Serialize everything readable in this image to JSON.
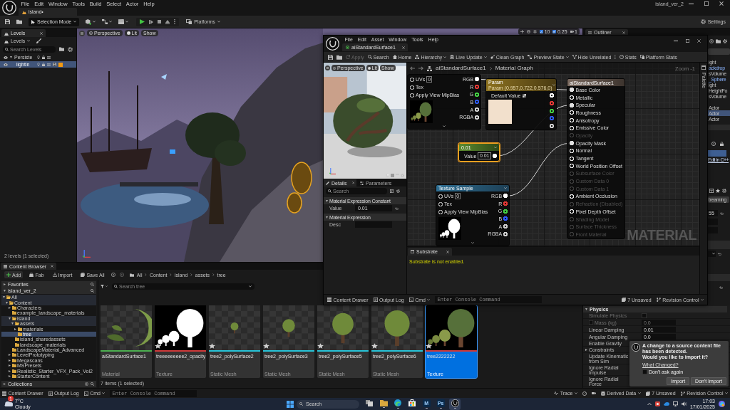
{
  "editor": {
    "menu": [
      "File",
      "Edit",
      "Window",
      "Tools",
      "Build",
      "Select",
      "Actor",
      "Help"
    ],
    "level_tab": {
      "label": "island•",
      "selected": true
    },
    "project": "island_ver_2",
    "toolbar": {
      "mode": "Selection Mode",
      "platforms": "Platforms",
      "settings": "Settings"
    }
  },
  "levels_panel": {
    "tab": "Levels",
    "dropdown": "Levels",
    "search": {
      "placeholder": "Search Levels"
    },
    "levels": [
      {
        "name": "Persiste",
        "selected": false,
        "current": false,
        "expanded": true
      },
      {
        "name": "lightin",
        "selected": true,
        "current": true,
        "color": "#f39a12"
      }
    ],
    "status": "2 levels (1 selected)"
  },
  "viewport": {
    "buttons": [
      "Perspective",
      "Lit",
      "Show"
    ],
    "snap_values": [
      "10",
      "0.25",
      "1"
    ]
  },
  "outliner": {
    "tab": "Outliner",
    "rows": [
      {
        "label": "ight",
        "selected": false,
        "highlighted": false
      },
      {
        "label": "ackdrop",
        "selected": false,
        "highlighted": true
      },
      {
        "label": "sVolume",
        "selected": false,
        "highlighted": false
      },
      {
        "label": "_Sphere",
        "selected": false,
        "highlighted": true
      },
      {
        "label": "ight",
        "selected": false,
        "highlighted": false
      },
      {
        "label": "HeightFo",
        "selected": false,
        "highlighted": false
      },
      {
        "label": "sVolume",
        "selected": false,
        "highlighted": false
      },
      {
        "label": "Actor",
        "selected": false,
        "highlighted": false
      },
      {
        "label": "Actor",
        "selected": true,
        "highlighted": false
      },
      {
        "label": "Actor",
        "selected": false,
        "highlighted": false
      }
    ]
  },
  "details_panel": {
    "edit_link": "Edit in C++",
    "streaming_button": "treaming",
    "field_value": "55",
    "physics": {
      "title": "Physics",
      "expanded": true,
      "rows": [
        {
          "label": "Simulate Physics",
          "kind": "checkbox",
          "checked": false,
          "disabled": true
        },
        {
          "label": "Mass (kg)",
          "kind": "number",
          "value": "0.0",
          "override_checked": false,
          "disabled": true
        },
        {
          "label": "Linear Damping",
          "kind": "number",
          "value": "0.01",
          "disabled": false
        },
        {
          "label": "Angular Damping",
          "kind": "number",
          "value": "0.0",
          "disabled": false
        },
        {
          "label": "Enable Gravity",
          "kind": "label",
          "disabled": false
        },
        {
          "label": "Constraints",
          "kind": "group",
          "expanded": false,
          "disabled": false
        },
        {
          "label": "Update Kinematic from Sim",
          "kind": "label",
          "disabled": false
        },
        {
          "label": "Ignore Radial Impulse",
          "kind": "label",
          "disabled": false
        },
        {
          "label": "Ignore Radial Force",
          "kind": "label",
          "disabled": false
        }
      ]
    }
  },
  "material_editor": {
    "menu": [
      "File",
      "Edit",
      "Asset",
      "Window",
      "Tools",
      "Help"
    ],
    "tab": {
      "label": "aiStandardSurface1",
      "selected": true
    },
    "toolbar": [
      {
        "label": "Apply",
        "disabled": true,
        "dropdown": false
      },
      {
        "label": "Search",
        "disabled": false,
        "dropdown": false
      },
      {
        "label": "Home",
        "disabled": false,
        "dropdown": false
      },
      {
        "label": "Hierarchy",
        "disabled": false,
        "dropdown": true
      },
      {
        "label": "Live Update",
        "disabled": false,
        "dropdown": true
      },
      {
        "label": "Clean Graph",
        "disabled": false,
        "dropdown": false
      },
      {
        "label": "Preview State",
        "disabled": false,
        "dropdown": true
      },
      {
        "label": "Hide Unrelated",
        "disabled": false,
        "dropdown": false
      },
      {
        "label": "Stats",
        "disabled": false,
        "dropdown": false
      },
      {
        "label": "Platform Stats",
        "disabled": false,
        "dropdown": false
      }
    ],
    "preview": {
      "buttons": [
        "Perspective",
        "Lit",
        "Show"
      ]
    },
    "details": {
      "tabs": [
        {
          "label": "Details",
          "selected": true
        },
        {
          "label": "Parameters",
          "selected": false
        }
      ],
      "search": {
        "placeholder": "Search"
      },
      "sections": [
        {
          "title": "Material Expression Constant",
          "rows": [
            {
              "label": "Value",
              "value": "0.01",
              "modified": true
            }
          ]
        },
        {
          "title": "Material Expression",
          "rows": [
            {
              "label": "Desc",
              "modified": false
            }
          ]
        }
      ]
    },
    "graph": {
      "breadcrumb": [
        "aiStandardSurface1",
        "Material Graph"
      ],
      "zoom": "Zoom -1",
      "label": "MATERIAL",
      "palette": "Palette",
      "nodes": [
        {
          "kind": "texture",
          "selected": false,
          "thumbnail": {
            "kind": "color"
          },
          "inputs": [
            {
              "label": "UVs",
              "value": "0",
              "connected": false
            },
            {
              "label": "Tex",
              "connected": false
            },
            {
              "label": "Apply View MipBias",
              "connected": false
            }
          ],
          "outputs": [
            {
              "label": "RGB",
              "color": "#ffffff",
              "connected": true
            },
            {
              "label": "R",
              "color": "#e53935",
              "connected": false
            },
            {
              "label": "G",
              "color": "#43d043",
              "connected": false
            },
            {
              "label": "B",
              "color": "#2f5bff",
              "connected": false
            },
            {
              "label": "A",
              "color": "#cfcfcf",
              "connected": false
            },
            {
              "label": "RGBA",
              "color": "#cfcfcf",
              "connected": false
            }
          ]
        },
        {
          "kind": "vector",
          "title": "Param",
          "subtitle": "Param (0.957,0.722,0.576,0)",
          "selected": false,
          "color": "#f2e0cc",
          "inputs": [
            {
              "label": "Default Value"
            }
          ],
          "outputs": [
            {
              "color": "#ffffff",
              "connected": false
            },
            {
              "color": "#e53935",
              "connected": false
            },
            {
              "color": "#43d043",
              "connected": false
            },
            {
              "color": "#2f5bff",
              "connected": false
            },
            {
              "color": "#cfcfcf",
              "connected": false
            }
          ]
        },
        {
          "kind": "constant",
          "title": "0.01",
          "selected": true,
          "inputs": [
            {
              "label": "Value",
              "value": "0.01"
            }
          ],
          "outputs": [
            {
              "color": "#ffffff",
              "connected": true
            }
          ]
        },
        {
          "kind": "texture",
          "title": "Texture Sample",
          "selected": false,
          "thumbnail": {
            "kind": "mask"
          },
          "inputs": [
            {
              "label": "UVs",
              "value": "0",
              "connected": false
            },
            {
              "label": "Tex",
              "connected": false
            },
            {
              "label": "Apply View MipBias",
              "connected": false
            }
          ],
          "outputs": [
            {
              "label": "RGB",
              "color": "#ffffff",
              "connected": true
            },
            {
              "label": "R",
              "color": "#e53935",
              "connected": false
            },
            {
              "label": "G",
              "color": "#43d043",
              "connected": false
            },
            {
              "label": "B",
              "color": "#2f5bff",
              "connected": false
            },
            {
              "label": "A",
              "color": "#cfcfcf",
              "connected": false
            },
            {
              "label": "RGBA",
              "color": "#cfcfcf",
              "connected": false
            }
          ]
        },
        {
          "kind": "result",
          "title": "aiStandardSurface1",
          "selected": false,
          "inputs": [
            {
              "label": "Base Color",
              "connected": true,
              "disabled": false
            },
            {
              "label": "Metallic",
              "connected": false,
              "disabled": false
            },
            {
              "label": "Specular",
              "connected": true,
              "disabled": false
            },
            {
              "label": "Roughness",
              "connected": false,
              "disabled": false
            },
            {
              "label": "Anisotropy",
              "connected": false,
              "disabled": false
            },
            {
              "label": "Emissive Color",
              "connected": false,
              "disabled": false
            },
            {
              "label": "Opacity",
              "connected": false,
              "disabled": true
            },
            {
              "label": "Opacity Mask",
              "connected": true,
              "disabled": false
            },
            {
              "label": "Normal",
              "connected": false,
              "disabled": false
            },
            {
              "label": "Tangent",
              "connected": false,
              "disabled": false
            },
            {
              "label": "World Position Offset",
              "connected": false,
              "disabled": false
            },
            {
              "label": "Subsurface Color",
              "connected": false,
              "disabled": true
            },
            {
              "label": "Custom Data 0",
              "connected": false,
              "disabled": true
            },
            {
              "label": "Custom Data 1",
              "connected": false,
              "disabled": true
            },
            {
              "label": "Ambient Occlusion",
              "connected": false,
              "disabled": false
            },
            {
              "label": "Refraction (Disabled)",
              "connected": false,
              "disabled": true
            },
            {
              "label": "Pixel Depth Offset",
              "connected": false,
              "disabled": false
            },
            {
              "label": "Shading Model",
              "connected": false,
              "disabled": true
            },
            {
              "label": "Surface Thickness",
              "connected": false,
              "disabled": true
            },
            {
              "label": "Front Material",
              "connected": false,
              "disabled": true
            }
          ]
        }
      ]
    },
    "substrate": {
      "tab": "Substrate",
      "message": "Substrate is not enabled."
    },
    "status_bar": {
      "content_drawer": "Content Drawer",
      "output_log": "Output Log",
      "cmd": "Cmd",
      "console": {
        "placeholder": "Enter Console Command"
      },
      "unsaved": "7 Unsaved",
      "revision_control": "Revision Control"
    }
  },
  "content_browser": {
    "tab": "Content Browser",
    "toolbar": [
      "Add",
      "Fab",
      "Import",
      "Save All"
    ],
    "breadcrumb": [
      "All",
      "Content",
      "island",
      "assets",
      "tree"
    ],
    "favorites": {
      "label": "Favorites",
      "expanded": false
    },
    "project": {
      "label": "island_ver_2",
      "expanded": true
    },
    "folders": [
      {
        "label": "All",
        "selected": false,
        "expanded": true,
        "children": [
          {
            "label": "Content",
            "selected": false,
            "expanded": true,
            "children": [
              {
                "label": "Characters",
                "selected": false,
                "expanded": false
              },
              {
                "label": "example_landscape_materials",
                "selected": false
              },
              {
                "label": "island",
                "selected": false,
                "expanded": true,
                "children": [
                  {
                    "label": "assets",
                    "selected": false,
                    "expanded": true,
                    "children": [
                      {
                        "label": "materials",
                        "selected": false,
                        "expanded": false
                      },
                      {
                        "label": "tree",
                        "selected": true
                      }
                    ]
                  },
                  {
                    "label": "island_sharedassets",
                    "selected": false
                  },
                  {
                    "label": "landscape_materials",
                    "selected": false
                  }
                ]
              },
              {
                "label": "LandscapeMaterial_Advanced",
                "selected": false
              },
              {
                "label": "LevelPrototyping",
                "selected": false,
                "expanded": false
              },
              {
                "label": "Megascans",
                "selected": false,
                "expanded": false
              },
              {
                "label": "MSPresets",
                "selected": false,
                "expanded": false
              },
              {
                "label": "Realistic_Starter_VFX_Pack_Vol2",
                "selected": false,
                "expanded": false
              },
              {
                "label": "StarterContent",
                "selected": false,
                "expanded": false
              }
            ]
          }
        ]
      }
    ],
    "collections": {
      "label": "Collections",
      "expanded": false
    },
    "search": {
      "placeholder": "Search tree"
    },
    "assets": [
      {
        "name": "aiStandardSurface1",
        "type": "Material",
        "thumbnail": {
          "kind": "sphere"
        },
        "color": "#4caf50",
        "selected": false
      },
      {
        "name": "treeeeeeeee2_opacity",
        "type": "Texture",
        "thumbnail": {
          "kind": "mask"
        },
        "color": "#d03a3a",
        "selected": false
      },
      {
        "name": "tree2_polySurface2",
        "type": "Static Mesh",
        "thumbnail": {
          "kind": "mesh"
        },
        "color": "#27c4d8",
        "selected": false
      },
      {
        "name": "tree2_polySurface3",
        "type": "Static Mesh",
        "thumbnail": {
          "kind": "mesh"
        },
        "color": "#27c4d8",
        "selected": false
      },
      {
        "name": "tree2_polySurface5",
        "type": "Static Mesh",
        "thumbnail": {
          "kind": "mesh"
        },
        "color": "#27c4d8",
        "selected": false
      },
      {
        "name": "tree2_polySurface6",
        "type": "Static Mesh",
        "thumbnail": {
          "kind": "mesh"
        },
        "color": "#27c4d8",
        "selected": false
      },
      {
        "name": "tree2222222",
        "type": "Texture",
        "thumbnail": {
          "kind": "texture"
        },
        "color": "#d03a3a",
        "selected": true
      }
    ],
    "status": "7 items (1 selected)"
  },
  "status_bar": {
    "content_drawer": "Content Drawer",
    "output_log": "Output Log",
    "cmd": "Cmd",
    "console": {
      "placeholder": "Enter Console Command"
    },
    "trace": "Trace",
    "derived_data": "Derived Data",
    "unsaved": "7 Unsaved",
    "revision_control": "Revision Control"
  },
  "notification": {
    "message": "A change to a source content file has been detected.",
    "question": "Would you like to import it?",
    "link": "What Changed?",
    "checkbox": {
      "label": "Don't ask again",
      "checked": false
    },
    "buttons": [
      "Import",
      "Don't Import"
    ]
  },
  "taskbar": {
    "weather": {
      "temperature": "7°C",
      "condition": "Cloudy",
      "badge": "1"
    },
    "search": {
      "placeholder": "Search"
    },
    "apps": [
      {
        "kind": "task_view",
        "running": false,
        "selected": false
      },
      {
        "kind": "folder",
        "running": true,
        "selected": false
      },
      {
        "kind": "browser",
        "running": true,
        "selected": false
      },
      {
        "kind": "store",
        "running": false,
        "selected": false
      },
      {
        "kind": "tile",
        "label": "M",
        "running": true,
        "selected": false
      },
      {
        "kind": "tile",
        "label": "Ps",
        "running": true,
        "selected": false
      },
      {
        "kind": "unreal",
        "running": true,
        "selected": true
      }
    ],
    "time": "17:03",
    "date": "17/01/2025"
  }
}
